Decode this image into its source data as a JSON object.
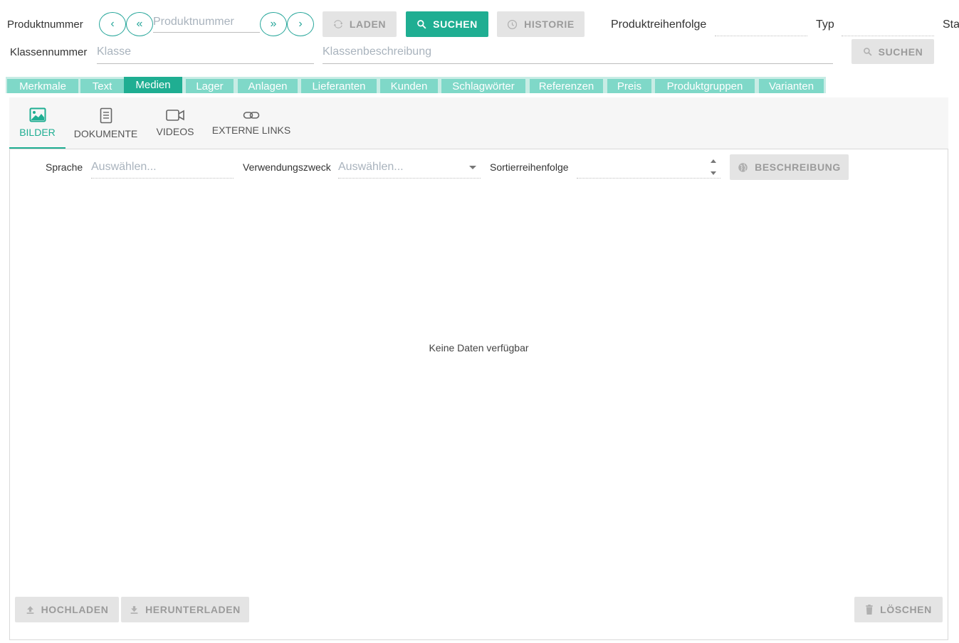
{
  "header": {
    "product_number_label": "Produktnummer",
    "product_number_placeholder": "Produktnummer",
    "nav_prev": "‹",
    "nav_first": "«",
    "nav_last": "»",
    "nav_next": "›",
    "load_label": "LADEN",
    "search_label": "SUCHEN",
    "history_label": "HISTORIE",
    "product_order_label": "Produktreihenfolge",
    "type_label": "Typ",
    "status_label_partial": "Sta",
    "class_number_label": "Klassennummer",
    "class_placeholder": "Klasse",
    "class_description_placeholder": "Klassenbeschreibung",
    "class_search_label": "SUCHEN"
  },
  "tabs": [
    {
      "label": "Merkmale"
    },
    {
      "label": "Text"
    },
    {
      "label": "Medien"
    },
    {
      "label": "Lager"
    },
    {
      "label": "Anlagen"
    },
    {
      "label": "Lieferanten"
    },
    {
      "label": "Kunden"
    },
    {
      "label": "Schlagwörter"
    },
    {
      "label": "Referenzen"
    },
    {
      "label": "Preis"
    },
    {
      "label": "Produktgruppen"
    },
    {
      "label": "Varianten"
    }
  ],
  "active_tab": "Medien",
  "subtabs": [
    {
      "label": "BILDER",
      "icon": "image-icon"
    },
    {
      "label": "DOKUMENTE",
      "icon": "document-icon"
    },
    {
      "label": "VIDEOS",
      "icon": "video-icon"
    },
    {
      "label": "EXTERNE LINKS",
      "icon": "link-icon"
    }
  ],
  "active_subtab": "BILDER",
  "filters": {
    "language_label": "Sprache",
    "language_placeholder": "Auswählen...",
    "purpose_label": "Verwendungszweck",
    "purpose_placeholder": "Auswählen...",
    "sort_label": "Sortierreihenfolge",
    "description_label": "BESCHREIBUNG"
  },
  "empty_text": "Keine Daten verfügbar",
  "footer": {
    "upload_label": "HOCHLADEN",
    "download_label": "HERUNTERLADEN",
    "delete_label": "LÖSCHEN"
  },
  "colors": {
    "accent": "#1fae92",
    "tab_inactive": "#7fd8c8",
    "tab_strip": "#c8ece5",
    "button_disabled": "#e4e4e4"
  }
}
